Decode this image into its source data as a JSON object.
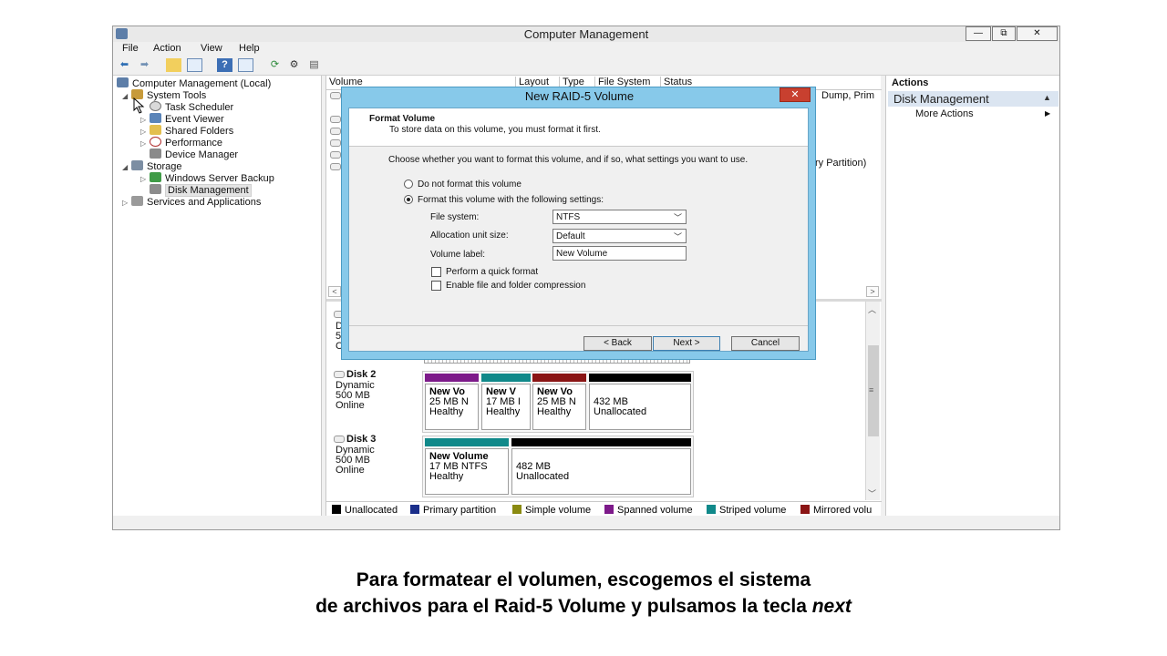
{
  "window": {
    "title": "Computer Management",
    "controls": [
      "—",
      "⧉",
      "✕"
    ]
  },
  "menu": [
    "File",
    "Action",
    "View",
    "Help"
  ],
  "tree": {
    "items": [
      {
        "label": "Computer Management (Local)",
        "expander": ""
      },
      {
        "label": "System Tools",
        "expander": "◢"
      },
      {
        "label": "Task Scheduler",
        "expander": ""
      },
      {
        "label": "Event Viewer",
        "expander": "▷"
      },
      {
        "label": "Shared Folders",
        "expander": "▷"
      },
      {
        "label": "Performance",
        "expander": "▷"
      },
      {
        "label": "Device Manager",
        "expander": ""
      },
      {
        "label": "Storage",
        "expander": "◢"
      },
      {
        "label": "Windows Server Backup",
        "expander": "▷"
      },
      {
        "label": "Disk Management",
        "expander": ""
      },
      {
        "label": "Services and Applications",
        "expander": "▷"
      }
    ]
  },
  "volume_list": {
    "columns": [
      "Volume",
      "Layout",
      "Type",
      "File System",
      "Status"
    ],
    "partial_texts": [
      "Dump, Prim",
      "ry Partition)"
    ],
    "scroll_left": "<",
    "scroll_right": ">"
  },
  "disks": {
    "disk1_partial": [
      "D",
      "5",
      "C"
    ],
    "disk2": {
      "name": "Disk 2",
      "type": "Dynamic",
      "size": "500 MB",
      "status": "Online",
      "partitions": [
        {
          "name": "New Vo",
          "size": "25 MB N",
          "status": "Healthy",
          "color": "#7d1a8a"
        },
        {
          "name": "New V",
          "size": "17 MB I",
          "status": "Healthy",
          "color": "#10898a"
        },
        {
          "name": "New Vo",
          "size": "25 MB N",
          "status": "Healthy",
          "color": "#8a1414"
        },
        {
          "name": "",
          "size": "432 MB",
          "status": "Unallocated",
          "color": "#000000"
        }
      ]
    },
    "disk3": {
      "name": "Disk 3",
      "type": "Dynamic",
      "size": "500 MB",
      "status": "Online",
      "partitions": [
        {
          "name": "New Volume",
          "size": "17 MB NTFS",
          "status": "Healthy",
          "color": "#10898a"
        },
        {
          "name": "",
          "size": "482 MB",
          "status": "Unallocated",
          "color": "#000000"
        }
      ]
    }
  },
  "legend": [
    {
      "label": "Unallocated",
      "color": "#000000"
    },
    {
      "label": "Primary partition",
      "color": "#1a2e8a"
    },
    {
      "label": "Simple volume",
      "color": "#8a8a10"
    },
    {
      "label": "Spanned volume",
      "color": "#7d1a8a"
    },
    {
      "label": "Striped volume",
      "color": "#10898a"
    },
    {
      "label": "Mirrored volu",
      "color": "#8a1414"
    }
  ],
  "actions": {
    "header": "Actions",
    "section": "Disk Management",
    "section_caret": "▲",
    "more": "More Actions",
    "more_arrow": "▶"
  },
  "dialog": {
    "title": "New RAID-5 Volume",
    "close": "✕",
    "header_title": "Format Volume",
    "header_sub": "To store data on this volume, you must format it first.",
    "prompt": "Choose whether you want to format this volume, and if so, what settings you want to use.",
    "radio_no_format": "Do not format this volume",
    "radio_format": "Format this volume with the following settings:",
    "fs_label": "File system:",
    "fs_value": "NTFS",
    "alloc_label": "Allocation unit size:",
    "alloc_value": "Default",
    "vol_label": "Volume label:",
    "vol_value": "New Volume",
    "quick_format": "Perform a quick format",
    "compression": "Enable file and folder compression",
    "back": "< Back",
    "next": "Next >",
    "cancel": "Cancel",
    "selected_radio": "format",
    "quick_format_checked": false,
    "compression_checked": false
  },
  "caption": {
    "line1": "Para formatear el volumen, escogemos el sistema",
    "line2_a": "de archivos para el Raid-5 Volume y pulsamos la tecla ",
    "line2_b": "next"
  }
}
